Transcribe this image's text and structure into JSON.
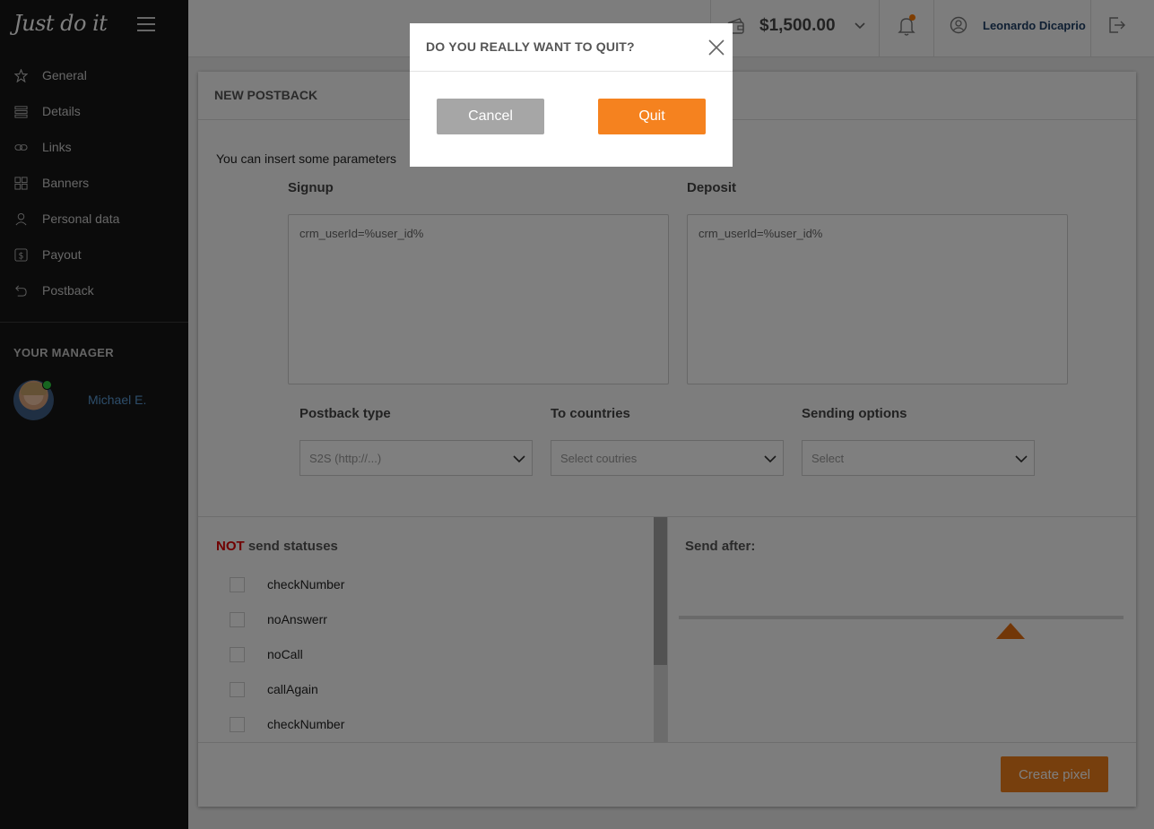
{
  "app": {
    "logo": "Just do it"
  },
  "sidebar": {
    "items": [
      {
        "label": "General",
        "icon": "star-icon"
      },
      {
        "label": "Details",
        "icon": "list-icon"
      },
      {
        "label": "Links",
        "icon": "link-icon"
      },
      {
        "label": "Banners",
        "icon": "grid-icon"
      },
      {
        "label": "Personal data",
        "icon": "person-icon"
      },
      {
        "label": "Payout",
        "icon": "dollar-icon"
      },
      {
        "label": "Postback",
        "icon": "return-arrow-icon"
      }
    ],
    "manager_title": "YOUR MANAGER",
    "manager_name": "Michael E."
  },
  "topbar": {
    "balance": "$1,500.00",
    "user_name": "Leonardo Dicaprio",
    "notification_dot_color": "#ff7a00"
  },
  "main": {
    "title": "NEW POSTBACK",
    "hint": "You can insert some parameters",
    "signup": {
      "label": "Signup",
      "value": "crm_userId=%user_id%"
    },
    "deposit": {
      "label": "Deposit",
      "value": "crm_userId=%user_id%"
    },
    "postback_type": {
      "label": "Postback type",
      "value": "S2S (http://...)"
    },
    "countries": {
      "label": "To countries",
      "placeholder": "Select coutries"
    },
    "sending_options": {
      "label": "Sending options",
      "placeholder": "Select"
    },
    "statuses": {
      "title_prefix": "NOT",
      "title_rest": " send statuses",
      "items": [
        "checkNumber",
        "noAnswerr",
        "noCall",
        "callAgain",
        "checkNumber"
      ]
    },
    "send_after": {
      "label": "Send after:"
    },
    "create_button": "Create pixel"
  },
  "modal": {
    "title": "DO YOU REALLY WANT TO QUIT?",
    "cancel": "Cancel",
    "quit": "Quit",
    "accent_color": "#f5821f"
  }
}
